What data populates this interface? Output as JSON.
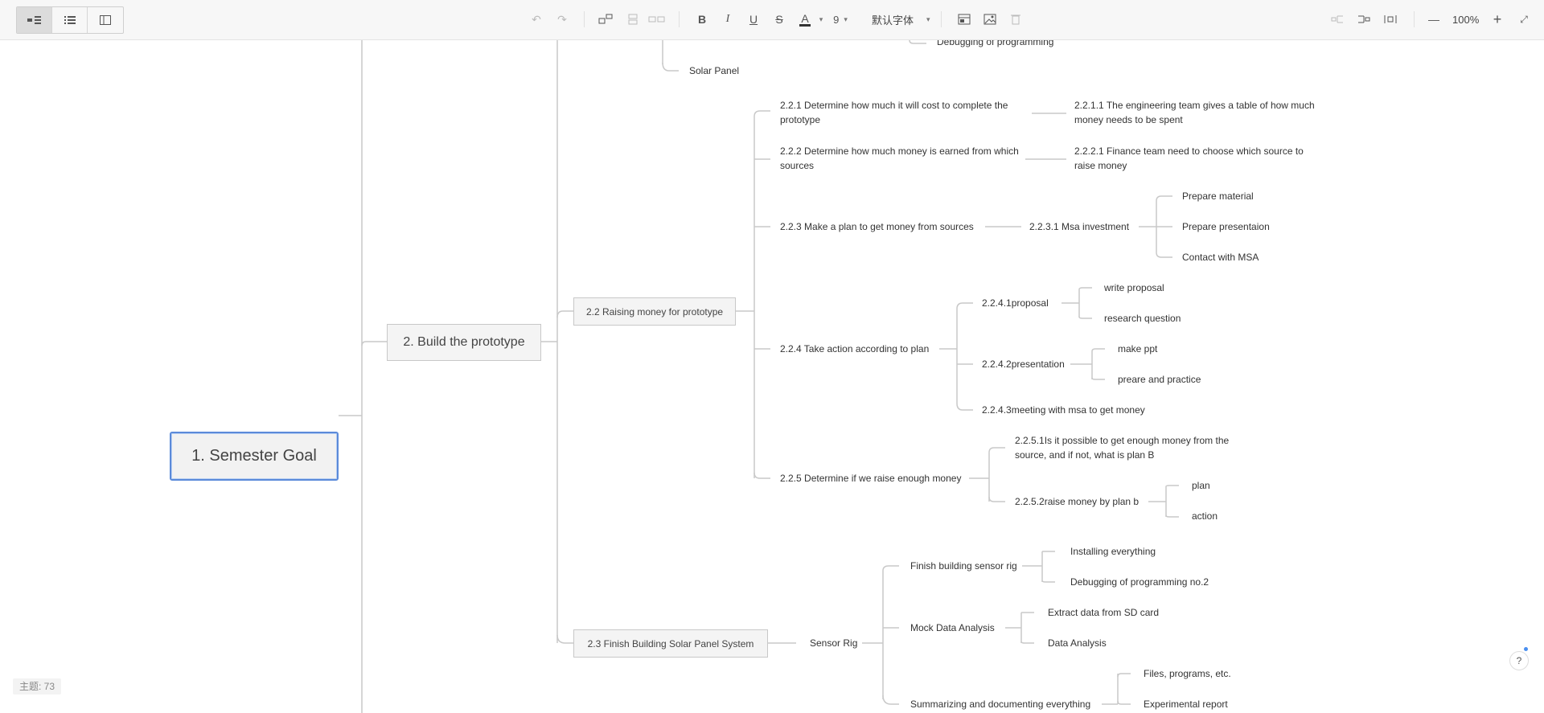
{
  "toolbar": {
    "views": [
      "outline-tree",
      "list",
      "panel"
    ],
    "font_size": "9",
    "font_family": "默认字体",
    "zoom": "100%",
    "bold": "B",
    "italic": "I",
    "underline": "U",
    "strike": "S",
    "font_color": "A",
    "zoom_out": "—",
    "zoom_in": "+"
  },
  "mindmap": {
    "root": "1. Semester Goal",
    "level1": "2. Build the prototype",
    "top_partial": {
      "debugging": "Debugging of programming",
      "solar_panel": "Solar Panel"
    },
    "n22": {
      "label": "2.2 Raising money for prototype",
      "n221": "2.2.1 Determine how much it will cost to complete the prototype",
      "n2211": "2.2.1.1 The engineering team gives a table of how much money needs to be spent",
      "n222": "2.2.2 Determine how much money is earned from which sources",
      "n2221": "2.2.2.1 Finance team need to choose which source to raise money",
      "n223": "2.2.3 Make a plan to get money from sources",
      "n2231": "2.2.3.1 Msa investment",
      "n2231_children": [
        "Prepare material",
        "Prepare presentaion",
        "Contact with MSA"
      ],
      "n224": "2.2.4 Take action according to plan",
      "n2241": "2.2.4.1proposal",
      "n2241_children": [
        "write proposal",
        "research question"
      ],
      "n2242": "2.2.4.2presentation",
      "n2242_children": [
        "make ppt",
        "preare and practice"
      ],
      "n2243": "2.2.4.3meeting with msa to get money",
      "n225": "2.2.5 Determine if we raise enough money",
      "n2251": "2.2.5.1Is it possible to get enough money from the source, and if not, what is plan B",
      "n2252": "2.2.5.2raise money by plan b",
      "n2252_children": [
        "plan",
        "action"
      ]
    },
    "n23": {
      "label": "2.3 Finish Building Solar Panel System",
      "sensor_rig": "Sensor Rig",
      "finish_sensor": "Finish building sensor rig",
      "finish_sensor_children": [
        "Installing everything",
        "Debugging of programming no.2"
      ],
      "mock": "Mock Data Analysis",
      "mock_children": [
        "Extract data from SD card",
        "Data Analysis"
      ],
      "summarizing": "Summarizing and documenting everything",
      "summarizing_children": [
        "Files, programs, etc.",
        "Experimental report"
      ]
    }
  },
  "status": {
    "topic_count": "主题: 73"
  },
  "colors": {
    "accent": "#5b8ad9",
    "line": "#c9c9c9"
  }
}
